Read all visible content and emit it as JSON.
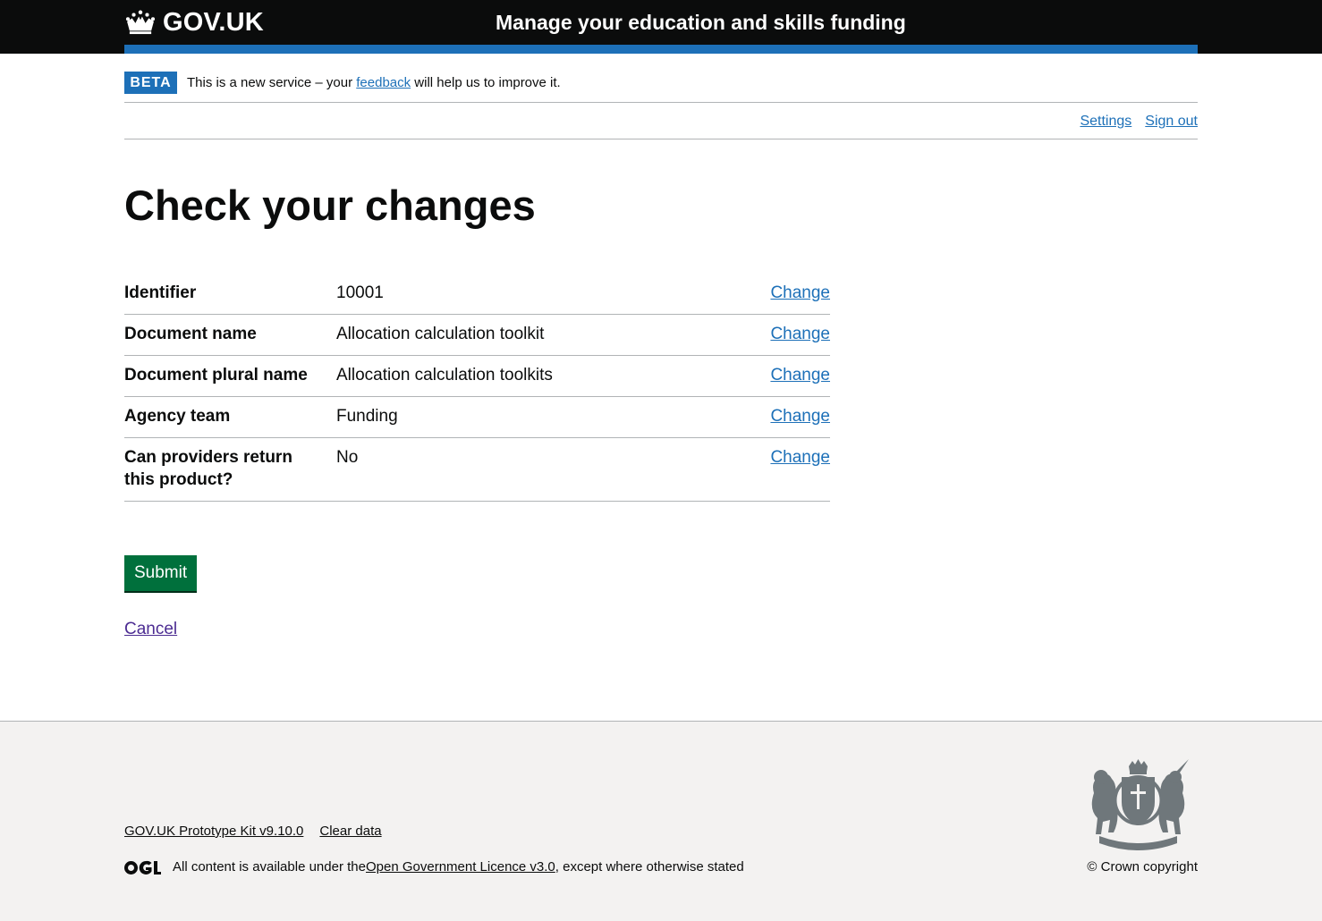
{
  "header": {
    "logo_text": "GOV.UK",
    "service_name": "Manage your education and skills funding"
  },
  "phase_banner": {
    "tag": "BETA",
    "text_before": "This is a new service – your ",
    "link": "feedback",
    "text_after": " will help us to improve it."
  },
  "account_nav": {
    "settings": "Settings",
    "sign_out": "Sign out"
  },
  "main": {
    "title": "Check your changes",
    "summary": [
      {
        "key": "Identifier",
        "value": "10001",
        "action": "Change"
      },
      {
        "key": "Document name",
        "value": "Allocation calculation toolkit",
        "action": "Change"
      },
      {
        "key": "Document plural name",
        "value": "Allocation calculation toolkits",
        "action": "Change"
      },
      {
        "key": "Agency team",
        "value": "Funding",
        "action": "Change"
      },
      {
        "key": "Can providers return this product?",
        "value": "No",
        "action": "Change"
      }
    ],
    "submit_label": "Submit",
    "cancel_label": "Cancel"
  },
  "footer": {
    "links": [
      "GOV.UK Prototype Kit v9.10.0",
      "Clear data"
    ],
    "licence_before": "All content is available under the ",
    "licence_link": "Open Government Licence v3.0",
    "licence_after": ", except where otherwise stated",
    "copyright": "© Crown copyright"
  },
  "colors": {
    "header_bg": "#0b0c0c",
    "brand_blue": "#1d70b8",
    "button_green": "#00703c",
    "visited_link": "#4c2c92",
    "footer_bg": "#f3f2f1"
  }
}
